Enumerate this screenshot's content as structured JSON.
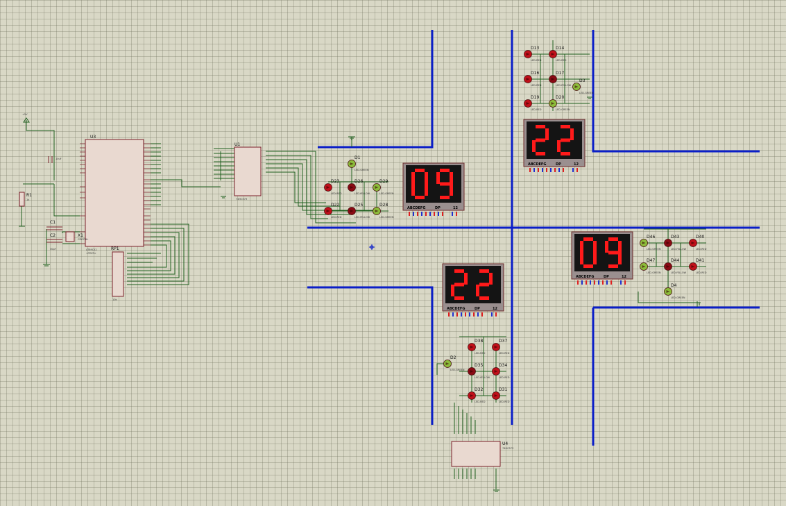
{
  "components": {
    "u3": {
      "ref": "U3",
      "part": "AT89C52",
      "text": "<TEXT>"
    },
    "u1": {
      "ref": "U1",
      "part": "74HC573",
      "text": "<TEXT>"
    },
    "u4": {
      "ref": "U4",
      "part": "74HC573",
      "text": "<TEXT>"
    },
    "r1": {
      "ref": "R1",
      "value": "1k",
      "text": "<TEXT>"
    },
    "c1": {
      "ref": "C1",
      "value": "30pF"
    },
    "c2": {
      "ref": "C2",
      "value": "30pF"
    },
    "x1": {
      "ref": "X1",
      "value": "CRYSTAL"
    },
    "rp1": {
      "ref": "RP1",
      "value": "10k"
    },
    "c3": {
      "ref": "C3",
      "value": "10uF"
    },
    "vcc": {
      "label": "+5V"
    }
  },
  "displays": [
    {
      "digits": "09",
      "footer_left": "ABCDEFG",
      "footer_mid": "DP",
      "footer_right": "12"
    },
    {
      "digits": "22",
      "footer_left": "ABCDEFG",
      "footer_mid": "DP",
      "footer_right": "12"
    },
    {
      "digits": "22",
      "footer_left": "ABCDEFG",
      "footer_mid": "DP",
      "footer_right": "12"
    },
    {
      "digits": "09",
      "footer_left": "ABCDEFG",
      "footer_mid": "DP",
      "footer_right": "12"
    }
  ],
  "leds": [
    {
      "ref": "D1",
      "type": "LED-GREEN"
    },
    {
      "ref": "D23",
      "type": "LED-RED"
    },
    {
      "ref": "D26",
      "type": "LED-YELLOW"
    },
    {
      "ref": "D29",
      "type": "LED-GREEN"
    },
    {
      "ref": "D22",
      "type": "LED-RED"
    },
    {
      "ref": "D25",
      "type": "LED-YELLOW"
    },
    {
      "ref": "D28",
      "type": "LED-GREEN"
    },
    {
      "ref": "D13",
      "type": "LED-RED"
    },
    {
      "ref": "D14",
      "type": "LED-RED"
    },
    {
      "ref": "D16",
      "type": "LED-RED"
    },
    {
      "ref": "D17",
      "type": "LED-YELLOW"
    },
    {
      "ref": "D3",
      "type": "LED-GREEN"
    },
    {
      "ref": "D19",
      "type": "LED-RED"
    },
    {
      "ref": "D20",
      "type": "LED-GREEN"
    },
    {
      "ref": "D46",
      "type": "LED-GREEN"
    },
    {
      "ref": "D43",
      "type": "LED-YELLOW"
    },
    {
      "ref": "D40",
      "type": "LED-RED"
    },
    {
      "ref": "D47",
      "type": "LED-GREEN"
    },
    {
      "ref": "D44",
      "type": "LED-YELLOW"
    },
    {
      "ref": "D41",
      "type": "LED-RED"
    },
    {
      "ref": "D4",
      "type": "LED-GREEN"
    },
    {
      "ref": "D38",
      "type": "LED-RED"
    },
    {
      "ref": "D37",
      "type": "LED-RED"
    },
    {
      "ref": "D2",
      "type": "LED-GREEN"
    },
    {
      "ref": "D35",
      "type": "LED-YELLOW"
    },
    {
      "ref": "D34",
      "type": "LED-RED"
    },
    {
      "ref": "D32",
      "type": "LED-RED"
    },
    {
      "ref": "D31",
      "type": "LED-RED"
    }
  ],
  "colors": {
    "background": "#d9d8c6",
    "grid": "#b6b5a2",
    "wire": "#1f5f1f",
    "road": "#0a1ec8",
    "chip": "#e9d9d0",
    "chip_border": "#7a1f2a",
    "display_bg": "#1a1a1a",
    "segment_on": "#ff1a1a",
    "pin_red": "#e02020",
    "pin_blue": "#2030d0"
  }
}
